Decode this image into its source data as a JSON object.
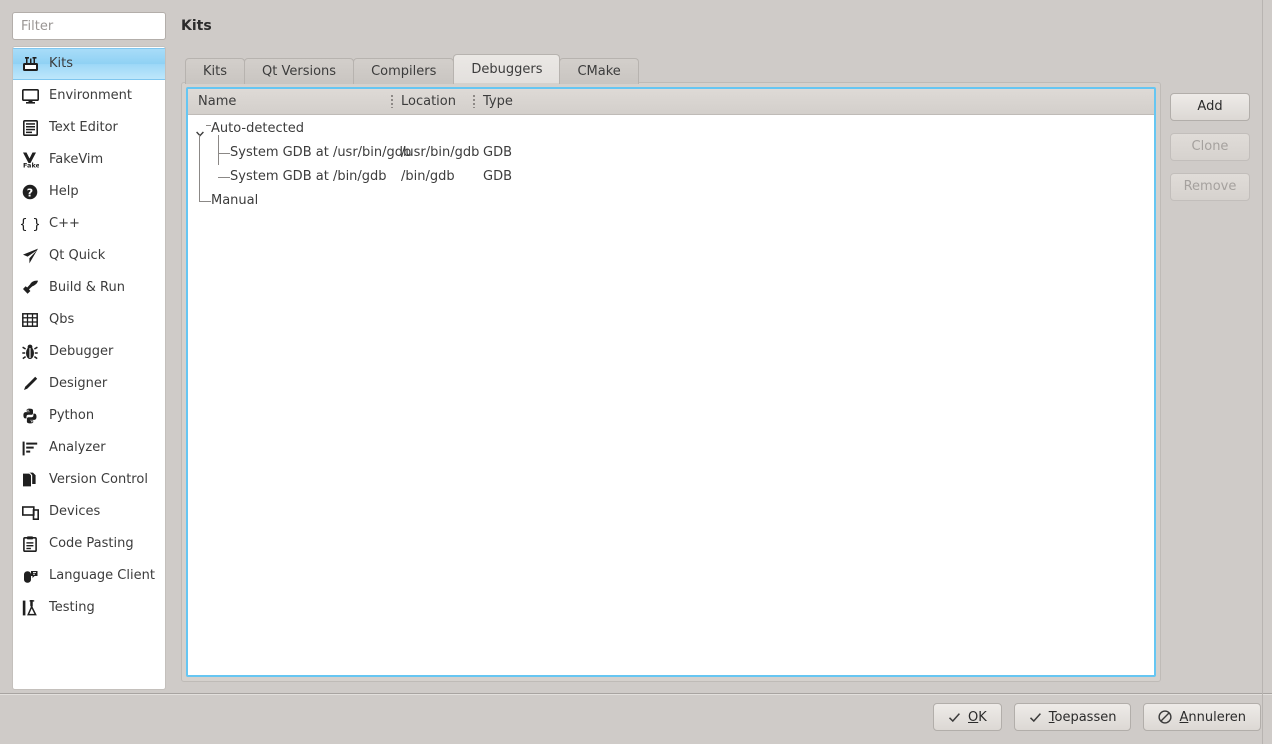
{
  "window": {
    "accent_color": "#66c6f2",
    "background_color": "#cfcbc8"
  },
  "search": {
    "placeholder": "Filter",
    "value": ""
  },
  "sidebar": {
    "items": [
      {
        "label": "Kits",
        "icon": "kits-icon",
        "selected": true
      },
      {
        "label": "Environment",
        "icon": "monitor-icon",
        "selected": false
      },
      {
        "label": "Text Editor",
        "icon": "text-editor-icon",
        "selected": false
      },
      {
        "label": "FakeVim",
        "icon": "fakevim-icon",
        "selected": false
      },
      {
        "label": "Help",
        "icon": "help-icon",
        "selected": false
      },
      {
        "label": "C++",
        "icon": "braces-icon",
        "selected": false
      },
      {
        "label": "Qt Quick",
        "icon": "paper-plane-icon",
        "selected": false
      },
      {
        "label": "Build & Run",
        "icon": "hammer-icon",
        "selected": false
      },
      {
        "label": "Qbs",
        "icon": "grid-icon",
        "selected": false
      },
      {
        "label": "Debugger",
        "icon": "bug-icon",
        "selected": false
      },
      {
        "label": "Designer",
        "icon": "pencil-icon",
        "selected": false
      },
      {
        "label": "Python",
        "icon": "python-icon",
        "selected": false
      },
      {
        "label": "Analyzer",
        "icon": "analyzer-icon",
        "selected": false
      },
      {
        "label": "Version Control",
        "icon": "version-control-icon",
        "selected": false
      },
      {
        "label": "Devices",
        "icon": "devices-icon",
        "selected": false
      },
      {
        "label": "Code Pasting",
        "icon": "clipboard-icon",
        "selected": false
      },
      {
        "label": "Language Client",
        "icon": "language-client-icon",
        "selected": false
      },
      {
        "label": "Testing",
        "icon": "testing-icon",
        "selected": false
      }
    ]
  },
  "header": {
    "title": "Kits"
  },
  "tabs": [
    {
      "label": "Kits",
      "active": false
    },
    {
      "label": "Qt Versions",
      "active": false
    },
    {
      "label": "Compilers",
      "active": false
    },
    {
      "label": "Debuggers",
      "active": true
    },
    {
      "label": "CMake",
      "active": false
    }
  ],
  "table": {
    "columns": [
      "Name",
      "Location",
      "Type"
    ],
    "rows": [
      {
        "name": "Auto-detected",
        "location": "",
        "type": "",
        "level": 0,
        "expanded": true
      },
      {
        "name": "System GDB at /usr/bin/gdb",
        "location": "/usr/bin/gdb",
        "type": "GDB",
        "level": 1
      },
      {
        "name": "System GDB at /bin/gdb",
        "location": "/bin/gdb",
        "type": "GDB",
        "level": 1
      },
      {
        "name": "Manual",
        "location": "",
        "type": "",
        "level": 0
      }
    ]
  },
  "side_buttons": [
    {
      "label": "Add",
      "enabled": true
    },
    {
      "label": "Clone",
      "enabled": false
    },
    {
      "label": "Remove",
      "enabled": false
    }
  ],
  "dialog_buttons": [
    {
      "label": "OK",
      "mnemonic": "O",
      "icon": "check-icon"
    },
    {
      "label": "Toepassen",
      "mnemonic": "T",
      "icon": "check-icon"
    },
    {
      "label": "Annuleren",
      "mnemonic": "A",
      "icon": "cancel-icon"
    }
  ]
}
